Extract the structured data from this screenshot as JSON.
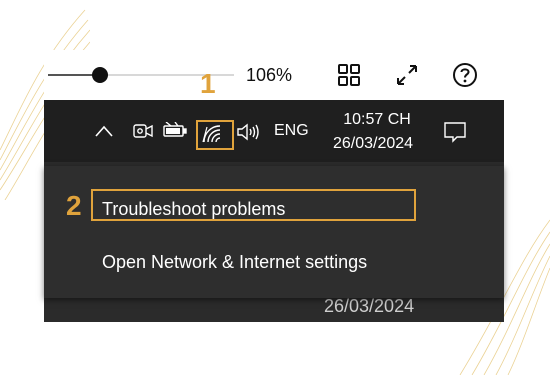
{
  "zoom_bar": {
    "zoom_level": 0.28,
    "zoom_label": "106%",
    "icons": [
      "grid-view-icon",
      "fullscreen-icon",
      "help-icon"
    ]
  },
  "steps": [
    "1",
    "2"
  ],
  "taskbar": {
    "tray_icons": [
      "chevron-up-icon",
      "camera-icon",
      "battery-icon",
      "wifi-icon",
      "volume-icon"
    ],
    "language": "ENG",
    "time": "10:57 CH",
    "date": "26/03/2024",
    "notification_icon": "notification-icon"
  },
  "context_menu": {
    "items": [
      {
        "label": "Troubleshoot problems"
      },
      {
        "label": "Open Network & Internet settings"
      }
    ]
  },
  "background": {
    "date": "26/03/2024"
  },
  "colors": {
    "accent_highlight": "#e0a33c",
    "taskbar_bg": "#1f1f1f",
    "menu_bg": "#2e2e2e",
    "text_light": "#ffffff"
  }
}
